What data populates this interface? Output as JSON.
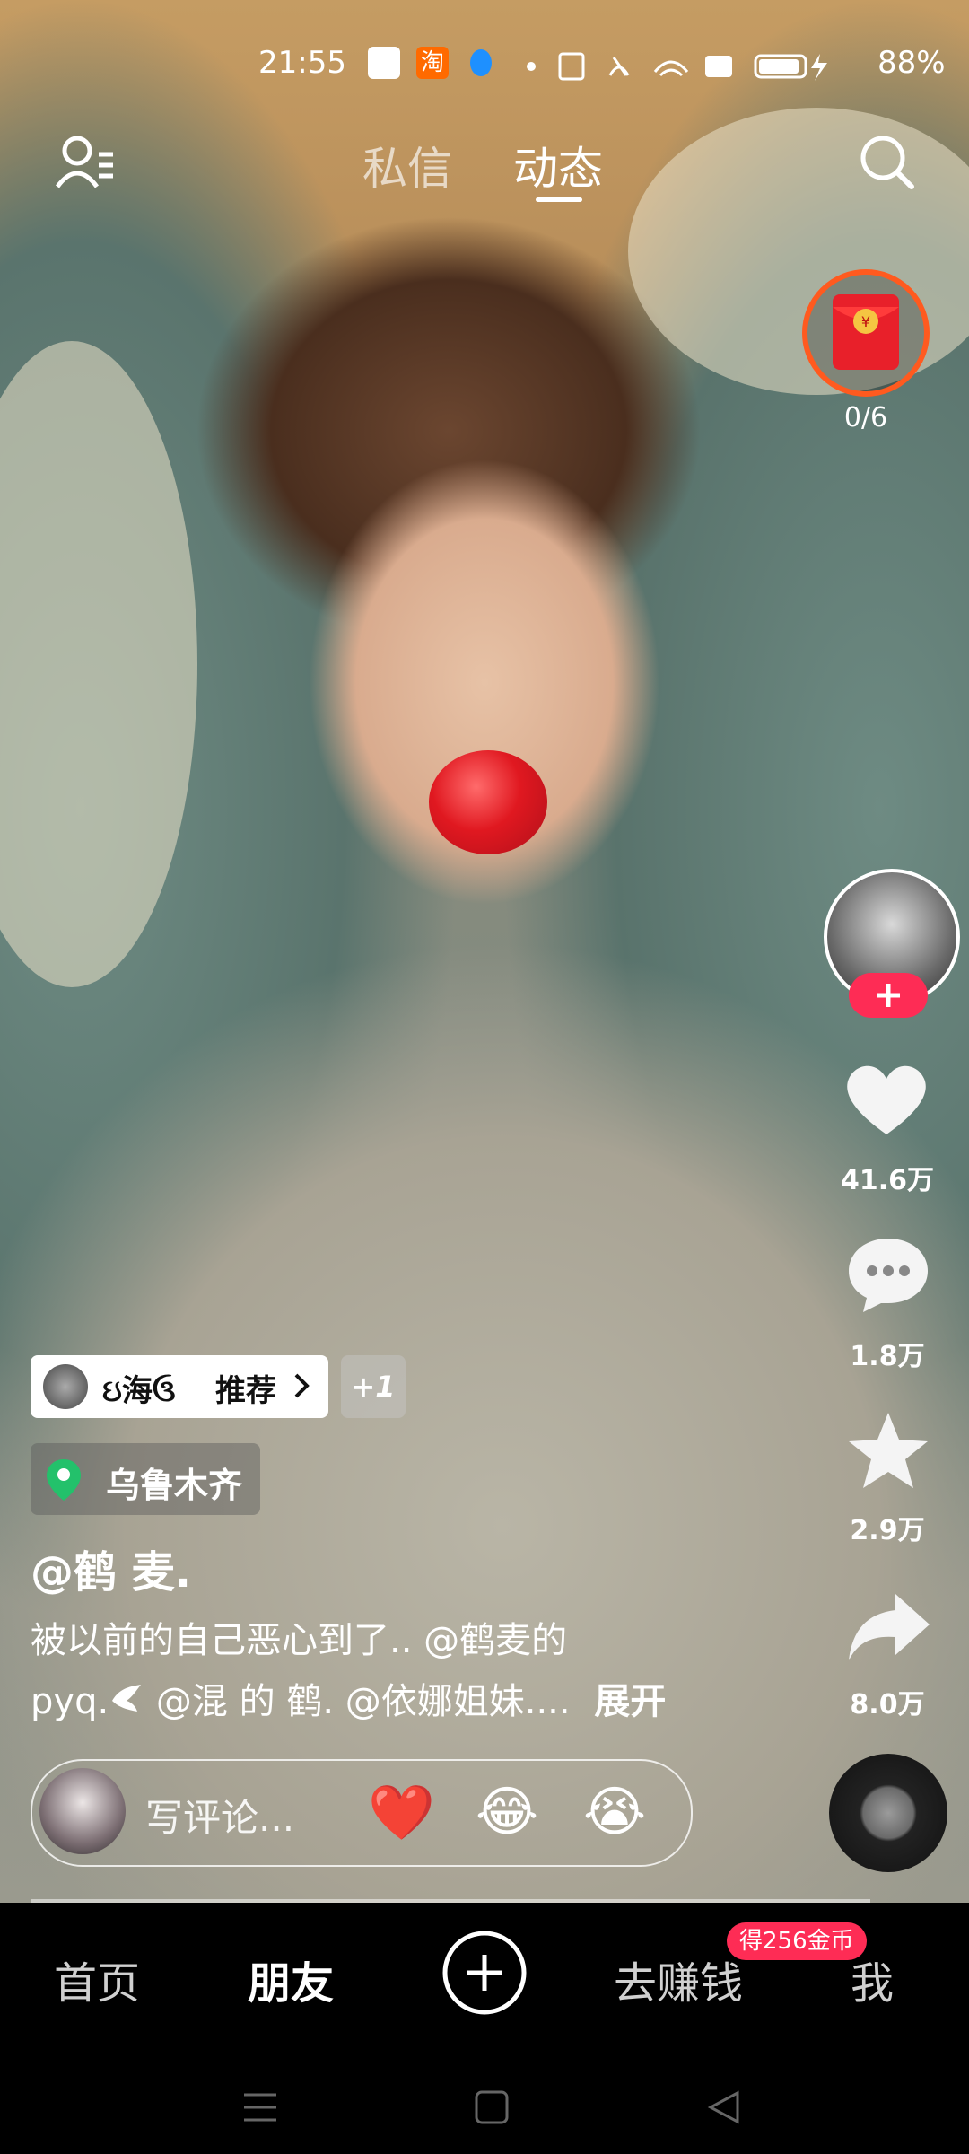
{
  "status_bar": {
    "time": "21:55",
    "battery": "88%",
    "app_icon_colors": [
      "#ffffff",
      "#ff6a00",
      "#1e90ff"
    ]
  },
  "top_nav": {
    "tabs": [
      {
        "label": "私信",
        "active": false
      },
      {
        "label": "动态",
        "active": true
      }
    ]
  },
  "red_packet": {
    "progress": "0/6"
  },
  "side_actions": {
    "likes": "41.6万",
    "comments": "1.8万",
    "favorites": "2.9万",
    "shares": "8.0万"
  },
  "recommend": {
    "user": "ઇ海ઉ",
    "label": "推荐",
    "extra": "+1"
  },
  "location": "乌鲁木齐",
  "author": "@鹤 麦.",
  "caption": {
    "line1": "被以前的自己恶心到了.. @鹤麦的",
    "line2_prefix": "pyq.",
    "line2_rest": " @混 的 鹤. @依娜姐妹....",
    "expand": "展开"
  },
  "comment_bar": {
    "placeholder": "写评论...",
    "emojis": [
      "❤️",
      "😂",
      "😭"
    ]
  },
  "bottom_nav": {
    "items": [
      "首页",
      "朋友",
      "去赚钱",
      "我"
    ],
    "active": "朋友",
    "coin_badge": "得256金币"
  },
  "colors": {
    "accent_pink": "#fe2c55",
    "location_green": "#23c16b"
  }
}
